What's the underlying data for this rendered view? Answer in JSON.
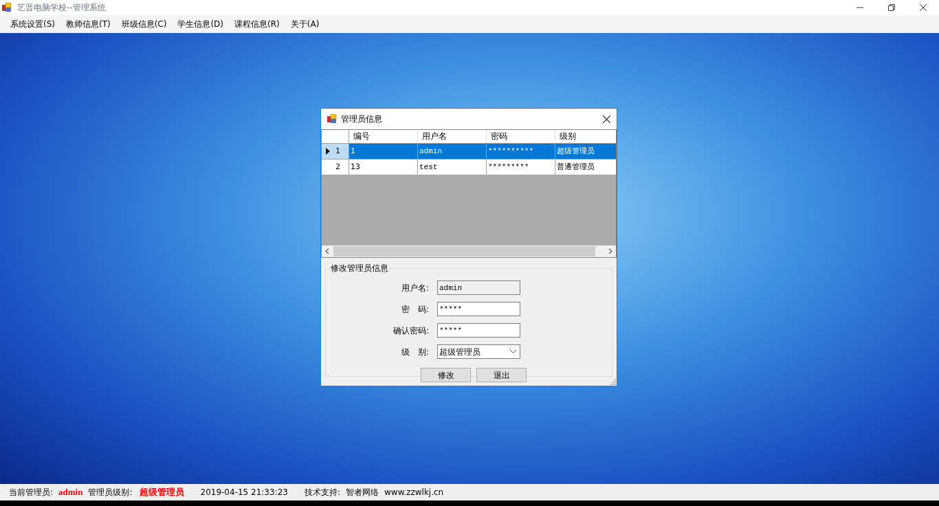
{
  "window": {
    "title": "艺晋电脑学校--管理系统"
  },
  "menu": [
    "系统设置(S)",
    "教师信息(T)",
    "班级信息(C)",
    "学生信息(D)",
    "课程信息(R)",
    "关于(A)"
  ],
  "dialog": {
    "title": "管理员信息",
    "grid": {
      "columns": [
        "编号",
        "用户名",
        "密码",
        "级别"
      ],
      "rows": [
        {
          "header": "1",
          "selected": true,
          "cells": [
            "1",
            "admin",
            "**********",
            "超级管理员"
          ]
        },
        {
          "header": "2",
          "selected": false,
          "cells": [
            "13",
            "test",
            "*********",
            "普通管理员"
          ]
        }
      ]
    },
    "form": {
      "title": "修改管理员信息",
      "fields": [
        {
          "kind": "text",
          "label": "用户名:",
          "value": "admin",
          "disabled": true
        },
        {
          "kind": "text",
          "label": "密　码:",
          "value": "*****",
          "disabled": false
        },
        {
          "kind": "text",
          "label": "确认密码:",
          "value": "*****",
          "disabled": false
        },
        {
          "kind": "dropdown",
          "label": "级　别:",
          "value": "超级管理员",
          "disabled": false
        }
      ],
      "buttons": [
        "修改",
        "退出"
      ]
    }
  },
  "status_bar": [
    {
      "kind": "label",
      "text": "当前管理员:"
    },
    {
      "kind": "value",
      "text": "admin"
    },
    {
      "kind": "label",
      "text": "管理员级别:"
    },
    {
      "kind": "value",
      "text": "超级管理员"
    },
    {
      "kind": "label",
      "text": "2019-04-15 21:33:23"
    },
    {
      "kind": "label",
      "text": "技术支持:"
    },
    {
      "kind": "label",
      "text": "智者网络"
    },
    {
      "kind": "label",
      "text": "www.zzwlkj.cn"
    }
  ]
}
